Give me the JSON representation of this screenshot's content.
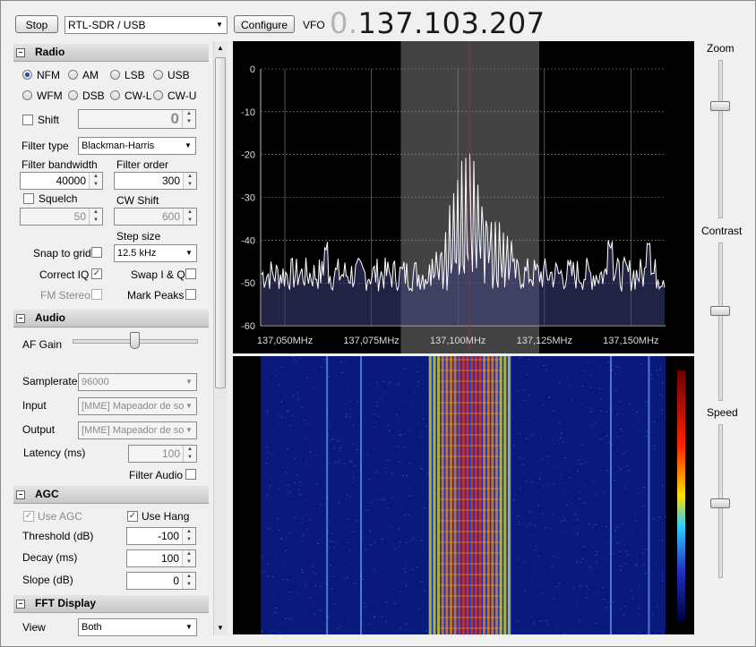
{
  "toolbar": {
    "stop_label": "Stop",
    "source": "RTL-SDR / USB",
    "configure_label": "Configure",
    "vfo_label": "VFO",
    "vfo_prefix": "0.",
    "vfo_value": "137.103.207"
  },
  "radio": {
    "title": "Radio",
    "modes": [
      {
        "label": "NFM",
        "selected": true
      },
      {
        "label": "AM",
        "selected": false
      },
      {
        "label": "LSB",
        "selected": false
      },
      {
        "label": "USB",
        "selected": false
      },
      {
        "label": "WFM",
        "selected": false
      },
      {
        "label": "DSB",
        "selected": false
      },
      {
        "label": "CW-L",
        "selected": false
      },
      {
        "label": "CW-U",
        "selected": false
      }
    ],
    "shift_label": "Shift",
    "shift_value": "0",
    "filter_type_label": "Filter type",
    "filter_type": "Blackman-Harris",
    "filter_bandwidth_label": "Filter bandwidth",
    "filter_bandwidth": "40000",
    "filter_order_label": "Filter order",
    "filter_order": "300",
    "squelch_label": "Squelch",
    "squelch_value": "50",
    "cw_shift_label": "CW Shift",
    "cw_shift_value": "600",
    "step_size_label": "Step size",
    "step_size": "12.5 kHz",
    "snap_label": "Snap to grid",
    "correct_iq_label": "Correct IQ",
    "swap_iq_label": "Swap I & Q",
    "fm_stereo_label": "FM Stereo",
    "mark_peaks_label": "Mark Peaks",
    "check_mark": "✓"
  },
  "audio": {
    "title": "Audio",
    "af_gain_label": "AF Gain",
    "af_gain": 0.5,
    "samplerate_label": "Samplerate",
    "samplerate": "96000",
    "input_label": "Input",
    "input": "[MME] Mapeador de so",
    "output_label": "Output",
    "output": "[MME] Mapeador de so",
    "latency_label": "Latency (ms)",
    "latency": "100",
    "filter_audio_label": "Filter Audio"
  },
  "agc": {
    "title": "AGC",
    "use_agc_label": "Use AGC",
    "use_hang_label": "Use Hang",
    "threshold_label": "Threshold (dB)",
    "threshold": "-100",
    "decay_label": "Decay (ms)",
    "decay": "100",
    "slope_label": "Slope (dB)",
    "slope": "0"
  },
  "fft": {
    "title": "FFT Display",
    "view_label": "View",
    "view": "Both"
  },
  "right": {
    "zoom_label": "Zoom",
    "contrast_label": "Contrast",
    "speed_label": "Speed",
    "zoom_level": 0.72,
    "contrast_level": 0.57,
    "speed_level": 0.48
  },
  "chart_data": {
    "type": "line",
    "ylim": [
      -60,
      0
    ],
    "y_ticks": [
      "0",
      "-10",
      "-20",
      "-30",
      "-40",
      "-50",
      "-60"
    ],
    "x_ticks": [
      "137,050MHz",
      "137,075MHz",
      "137,100MHz",
      "137,125MHz",
      "137,150MHz"
    ],
    "xlim": [
      137.043,
      137.16
    ],
    "filter_band": [
      137.0835,
      137.1235
    ],
    "vfo_mhz": 137.1032,
    "trace_color": "#ffffff",
    "vfo_color": "#e01010"
  }
}
